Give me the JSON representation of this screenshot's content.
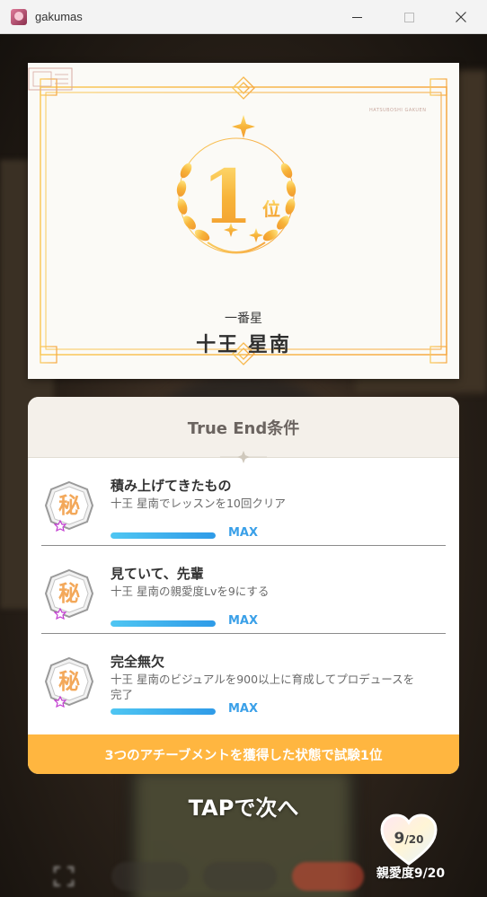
{
  "window": {
    "title": "gakumas"
  },
  "certificate": {
    "rank_number": "1",
    "rank_suffix": "位",
    "stamp_text": "HATSUBOSHI GAKUEN",
    "subtitle": "一番星",
    "name": "十王 星南"
  },
  "panel": {
    "title": "True End条件",
    "achievements": [
      {
        "title": "積み上げてきたもの",
        "description": "十王 星南でレッスンを10回クリア",
        "progress": 1.0,
        "status": "MAX",
        "icon": "achievement-medal-icon"
      },
      {
        "title": "見ていて、先輩",
        "description": "十王 星南の親愛度Lvを9にする",
        "progress": 1.0,
        "status": "MAX",
        "icon": "achievement-medal-icon"
      },
      {
        "title": "完全無欠",
        "description": "十王 星南のビジュアルを900以上に育成してプロデュースを完了",
        "progress": 1.0,
        "status": "MAX",
        "icon": "achievement-medal-icon"
      }
    ],
    "footer": "3つのアチーブメントを獲得した状態で試験1位"
  },
  "bottom": {
    "tap_next": "TAPで次へ",
    "affinity_current": "9",
    "affinity_max": "/20",
    "affinity_label": "親愛度9/20"
  },
  "colors": {
    "gold": "#f5b53a",
    "panel_footer": "#ffb640",
    "progress_blue": "#3aa0e8"
  }
}
